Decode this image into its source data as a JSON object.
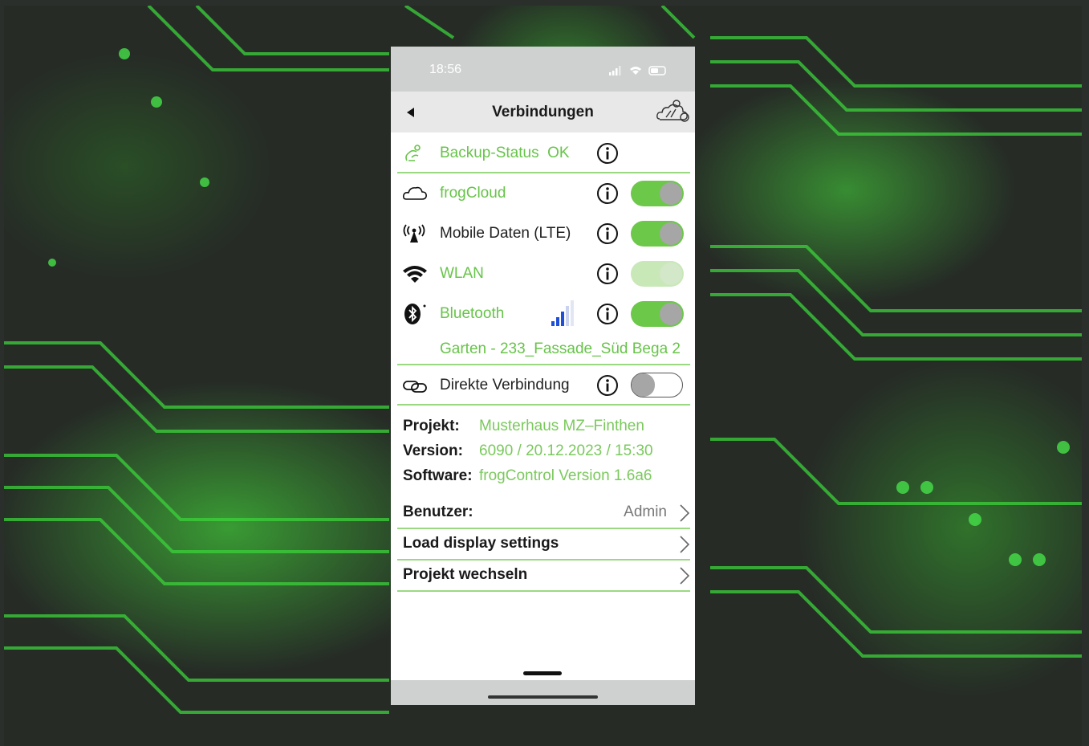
{
  "status_bar": {
    "time": "18:56"
  },
  "nav": {
    "title": "Verbindungen"
  },
  "backup": {
    "label": "Backup-Status",
    "status": "OK"
  },
  "connections": [
    {
      "label": "frogCloud",
      "enabled": true,
      "icon": "cloud-icon"
    },
    {
      "label": "Mobile Daten (LTE)",
      "enabled": true,
      "icon": "antenna-icon"
    },
    {
      "label": "WLAN",
      "enabled": true,
      "icon": "wifi-icon"
    },
    {
      "label": "Bluetooth",
      "enabled": true,
      "icon": "bluetooth-icon",
      "device": "Garten - 233_Fassade_Süd Bega 2",
      "signal_bars": 3
    },
    {
      "label": "Direkte Verbindung",
      "enabled": false,
      "icon": "link-icon"
    }
  ],
  "info": {
    "project_label": "Projekt:",
    "project_value": "Musterhaus MZ–Finthen",
    "version_label": "Version:",
    "version_value": "6090 / 20.12.2023 / 15:30",
    "software_label": "Software:",
    "software_value": "frogControl Version 1.6a6"
  },
  "menu": {
    "user_label": "Benutzer:",
    "user_value": "Admin",
    "load_display": "Load display settings",
    "switch_project": "Projekt wechseln"
  },
  "colors": {
    "accent": "#67c449",
    "toggle_on": "#6cc849",
    "statusbar": "#cfd1d0",
    "navbar": "#e8e8e8"
  }
}
